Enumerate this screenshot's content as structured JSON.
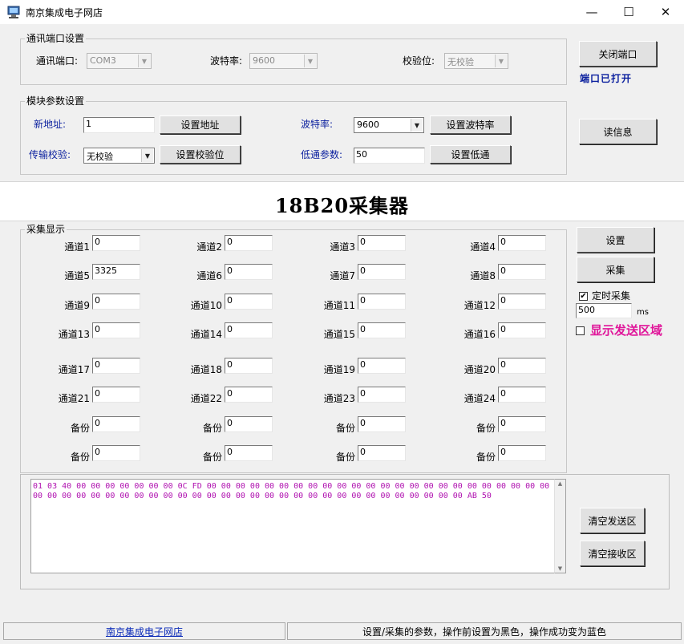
{
  "window": {
    "title": "南京集成电子网店",
    "min": "—",
    "max": "☐",
    "close": "✕"
  },
  "comm": {
    "legend": "通讯端口设置",
    "port_label": "通讯端口:",
    "port_value": "COM3",
    "baud_label": "波特率:",
    "baud_value": "9600",
    "parity_label": "校验位:",
    "parity_value": "无校验"
  },
  "close_port_button": "关闭端口",
  "port_status": "端口已打开",
  "read_info_button": "读信息",
  "module": {
    "legend": "模块参数设置",
    "new_addr_label": "新地址:",
    "new_addr_value": "1",
    "set_addr_button": "设置地址",
    "baud_label": "波特率:",
    "baud_value": "9600",
    "set_baud_button": "设置波特率",
    "parity_label": "传输校验:",
    "parity_value": "无校验",
    "set_parity_button": "设置校验位",
    "lowpass_label": "低通参数:",
    "lowpass_value": "50",
    "set_lowpass_button": "设置低通"
  },
  "banner": "18B20采集器",
  "collect": {
    "legend": "采集显示",
    "rows": [
      [
        {
          "label": "通道1",
          "value": "0"
        },
        {
          "label": "通道2",
          "value": "0"
        },
        {
          "label": "通道3",
          "value": "0"
        },
        {
          "label": "通道4",
          "value": "0"
        }
      ],
      [
        {
          "label": "通道5",
          "value": "3325"
        },
        {
          "label": "通道6",
          "value": "0"
        },
        {
          "label": "通道7",
          "value": "0"
        },
        {
          "label": "通道8",
          "value": "0"
        }
      ],
      [
        {
          "label": "通道9",
          "value": "0"
        },
        {
          "label": "通道10",
          "value": "0"
        },
        {
          "label": "通道11",
          "value": "0"
        },
        {
          "label": "通道12",
          "value": "0"
        }
      ],
      [
        {
          "label": "通道13",
          "value": "0"
        },
        {
          "label": "通道14",
          "value": "0"
        },
        {
          "label": "通道15",
          "value": "0"
        },
        {
          "label": "通道16",
          "value": "0"
        }
      ],
      [
        {
          "label": "通道17",
          "value": "0"
        },
        {
          "label": "通道18",
          "value": "0"
        },
        {
          "label": "通道19",
          "value": "0"
        },
        {
          "label": "通道20",
          "value": "0"
        }
      ],
      [
        {
          "label": "通道21",
          "value": "0"
        },
        {
          "label": "通道22",
          "value": "0"
        },
        {
          "label": "通道23",
          "value": "0"
        },
        {
          "label": "通道24",
          "value": "0"
        }
      ],
      [
        {
          "label": "备份",
          "value": "0"
        },
        {
          "label": "备份",
          "value": "0"
        },
        {
          "label": "备份",
          "value": "0"
        },
        {
          "label": "备份",
          "value": "0"
        }
      ],
      [
        {
          "label": "备份",
          "value": "0"
        },
        {
          "label": "备份",
          "value": "0"
        },
        {
          "label": "备份",
          "value": "0"
        },
        {
          "label": "备份",
          "value": "0"
        }
      ]
    ]
  },
  "side": {
    "setup_button": "设置",
    "collect_button": "采集",
    "timed_label": "定时采集",
    "timed_checked": "✔",
    "interval_value": "500",
    "interval_unit": "ms",
    "show_send_label": "显示发送区域"
  },
  "receive_text": "01 03 40 00 00 00 00 00 00 00 0C FD 00 00 00 00 00 00 00 00 00 00 00 00 00 00 00 00 00 00 00 00 00 00 00 00 00 00 00 00 00 00 00 00 00 00 00 00 00 00 00 00 00 00 00 00 00 00 00 00 00 00 00 00 00 00 AB 50",
  "clear_send_button": "清空发送区",
  "clear_recv_button": "清空接收区",
  "status": {
    "left_link": "南京集成电子网店",
    "right_text": "设置/采集的参数，操作前设置为黑色，操作成功变为蓝色"
  },
  "colors": {
    "label_blue": "#0a1f9e",
    "receive_text": "#b012b0",
    "show_send": "#e0169a"
  }
}
